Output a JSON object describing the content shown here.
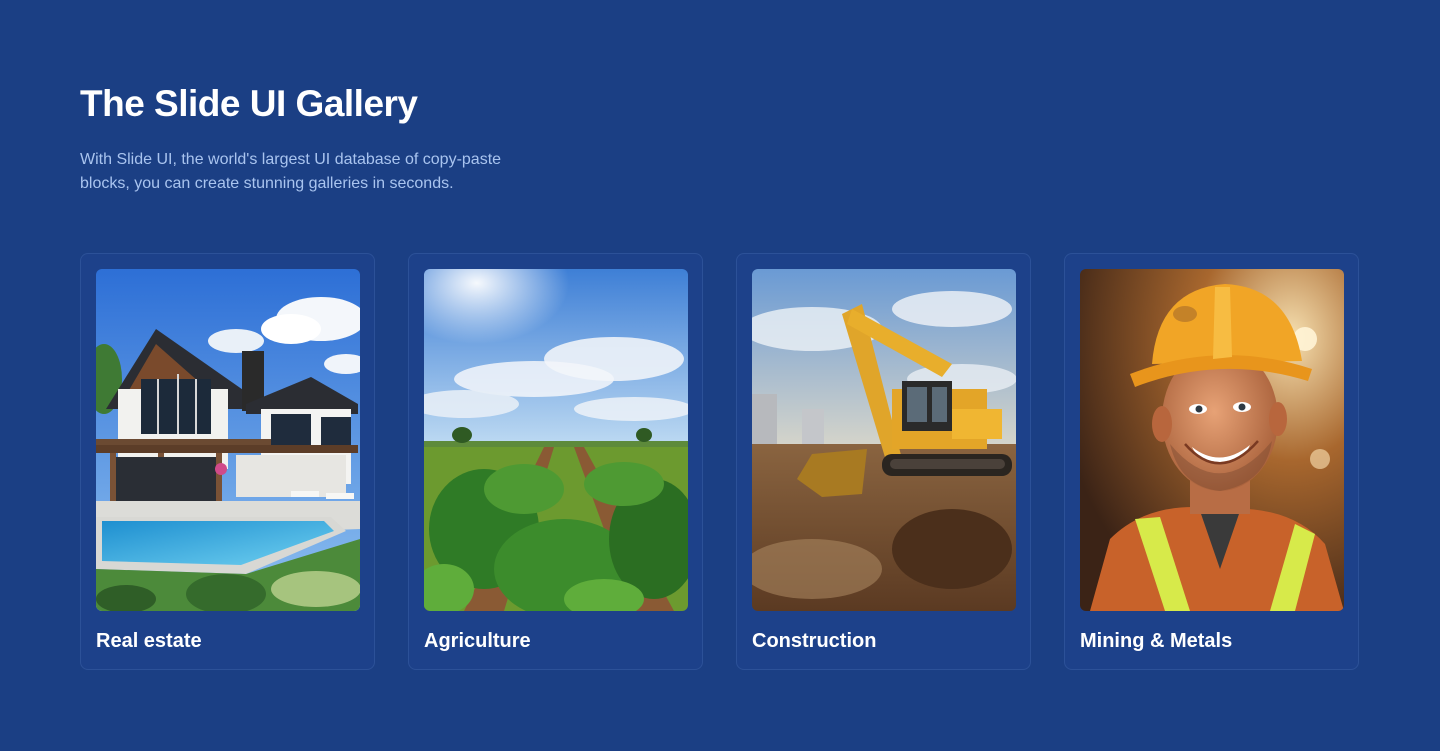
{
  "gallery": {
    "title": "The Slide UI Gallery",
    "subtitle": "With Slide UI, the world's largest UI database of copy-paste blocks, you can create stunning galleries in seconds."
  },
  "cards": [
    {
      "label": "Real estate",
      "image": "modern-house-with-pool"
    },
    {
      "label": "Agriculture",
      "image": "crop-field-under-blue-sky"
    },
    {
      "label": "Construction",
      "image": "excavator-on-muddy-site"
    },
    {
      "label": "Mining & Metals",
      "image": "smiling-worker-in-hard-hat"
    }
  ],
  "colors": {
    "background": "#1b3f84",
    "card_border": "#2c5198",
    "subtitle": "#a9c4ef"
  }
}
